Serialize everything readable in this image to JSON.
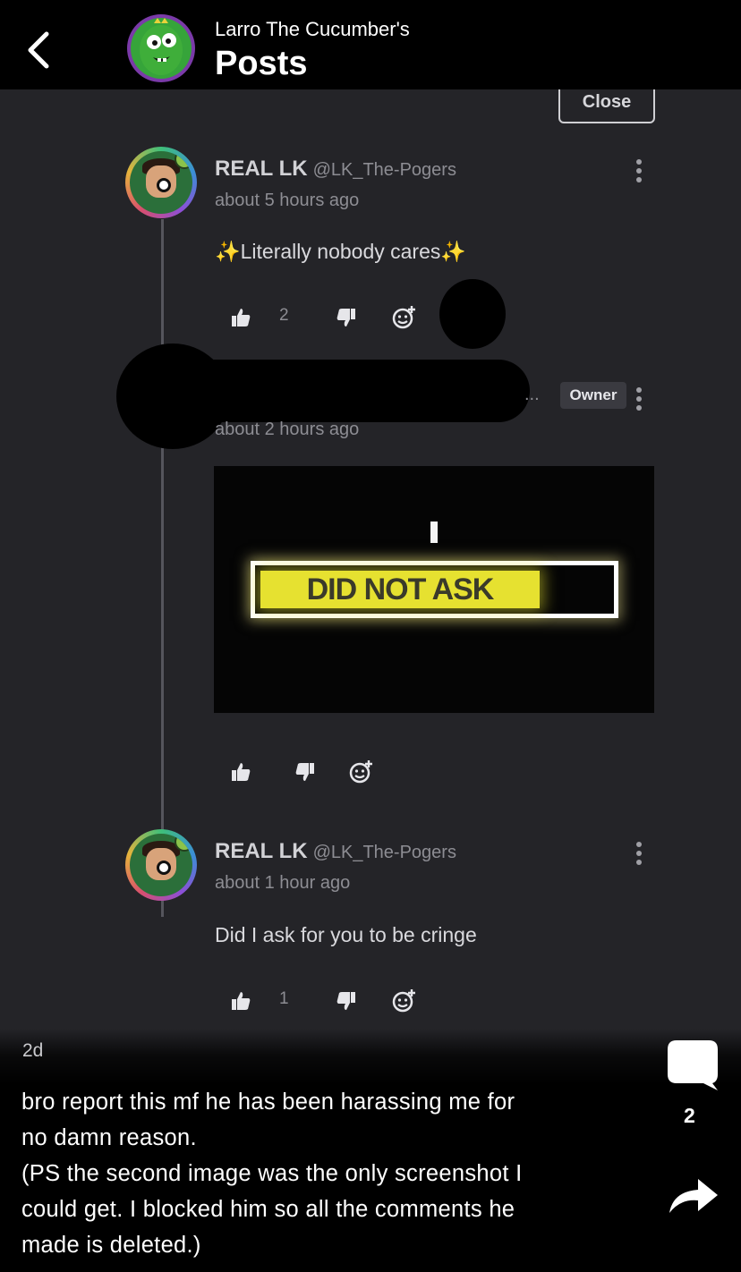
{
  "header": {
    "subtitle": "Larro The Cucumber's",
    "title": "Posts",
    "back_icon": "chevron-left-icon",
    "avatar": "cucumber-avatar"
  },
  "screenshot": {
    "close_label": "Close",
    "comments": [
      {
        "name": "REAL LK",
        "handle": "@LK_The-Pogers",
        "time": "about 5 hours ago",
        "body": "✨Literally nobody cares✨",
        "likes": "2"
      },
      {
        "name": "",
        "owner_badge": "Owner",
        "ellipsis": "...",
        "time": "about 2 hours ago",
        "image_text": "DID NOT ASK",
        "image_cursor_text": "I"
      },
      {
        "name": "REAL LK",
        "handle": "@LK_The-Pogers",
        "time": "about 1 hour ago",
        "body": "Did I ask for you to be cringe",
        "likes": "1"
      }
    ]
  },
  "post": {
    "age": "2d",
    "caption_lines": [
      "bro report this mf he has been harassing me for",
      "no damn reason.",
      "(PS the second image was the only screenshot I",
      "could get. I blocked him so all the comments he",
      "made is deleted.)"
    ],
    "comment_count": "2",
    "comment_icon": "speech-bubble-icon",
    "share_icon": "share-arrow-icon"
  },
  "colors": {
    "background": "#000000",
    "screenshot_bg": "#242428",
    "highlight_yellow": "#e6e130"
  }
}
